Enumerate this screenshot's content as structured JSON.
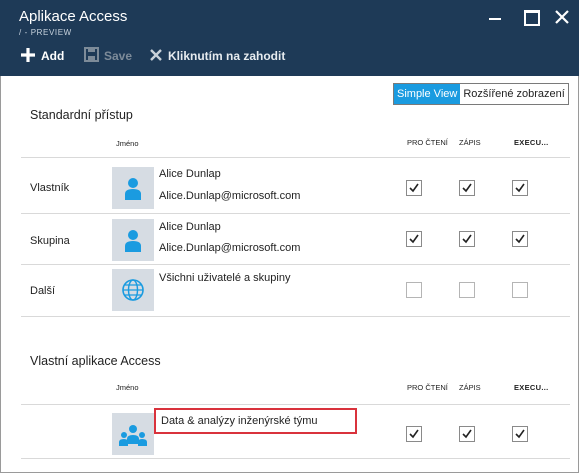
{
  "window": {
    "title": "Aplikace Access",
    "subtitle": "/ - PREVIEW"
  },
  "toolbar": {
    "add_label": "Add",
    "save_label": "Save",
    "discard_label": "Kliknutím na zahodit"
  },
  "view_toggle": {
    "simple": "Simple View",
    "advanced": "Rozšířené zobrazení",
    "selected": "Simple View"
  },
  "columns": {
    "name": "Jméno",
    "read": "PRO ČTENÍ",
    "write": "ZÁPIS",
    "execute": "EXECU..."
  },
  "standard_access": {
    "title": "Standardní přístup",
    "rows": [
      {
        "label": "Vlastník",
        "name": "Alice Dunlap",
        "email": "Alice.Dunlap@microsoft.com",
        "icon": "user-icon",
        "read": true,
        "write": true,
        "execute": true
      },
      {
        "label": "Skupina",
        "name": "Alice Dunlap",
        "email": "Alice.Dunlap@microsoft.com",
        "icon": "user-icon",
        "read": true,
        "write": true,
        "execute": true
      },
      {
        "label": "Další",
        "name": "Všichni uživatelé a skupiny",
        "email": "",
        "icon": "globe-icon",
        "read": false,
        "write": false,
        "execute": false
      }
    ]
  },
  "custom_access": {
    "title": "Vlastní aplikace Access",
    "rows": [
      {
        "label": "",
        "name": "Data & analýzy inženýrské týmu",
        "icon": "group-icon",
        "read": true,
        "write": true,
        "execute": true
      }
    ]
  },
  "colors": {
    "header_bg": "#1e3a57",
    "accent": "#1a9be0",
    "highlight_border": "#d9323c"
  }
}
